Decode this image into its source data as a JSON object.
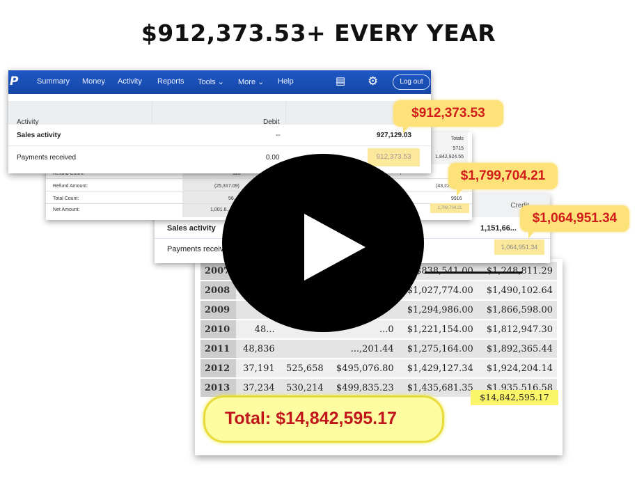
{
  "headline": "$912,373.53+ EVERY YEAR",
  "paypal": {
    "nav": [
      "Summary",
      "Money",
      "Activity",
      "Reports",
      "Tools ⌄",
      "More ⌄",
      "Help"
    ],
    "logout": "Log out",
    "icons": {
      "message": "▤",
      "settings": "⚙"
    },
    "columns": {
      "activity": "Activity",
      "debit": "Debit",
      "credit": "Credit"
    },
    "rows": [
      {
        "label": "Sales activity",
        "debit": "--",
        "credit": "927,129.03"
      },
      {
        "label": "Payments received",
        "debit": "0.00",
        "credit": "912,373.53"
      }
    ]
  },
  "panel2": {
    "totals_header": "Totals",
    "totals_values": [
      "9715",
      "1,842,924.55"
    ],
    "rows": [
      {
        "label": "Refund Count:",
        "v1": "120",
        "v2": "7"
      },
      {
        "label": "Refund Amount:",
        "v1": "(25,317.09)",
        "v2": "(43,22..."
      },
      {
        "label": "Total Count:",
        "v1": "56...",
        "v2": "9916"
      },
      {
        "label": "Net Amount:",
        "v1": "1,001.6...",
        "v2": "1,799,704.21"
      }
    ]
  },
  "panel3": {
    "credit_header": "Credit",
    "sales_label": "Sales activity",
    "sales_value": "1,151,66...",
    "payments_label": "Payments receive...",
    "payments_value": "1,064,951.34"
  },
  "year_table": [
    {
      "year": "2007",
      "c1": "",
      "c2": "",
      "c3": "",
      "c4": "$838,541.00",
      "c5": "$1,248,811.29"
    },
    {
      "year": "2008",
      "c1": "",
      "c2": "",
      "c3": "",
      "c4": "$1,027,774.00",
      "c5": "$1,490,102.64"
    },
    {
      "year": "2009",
      "c1": "",
      "c2": "",
      "c3": "",
      "c4": "$1,294,986.00",
      "c5": "$1,866,598.00"
    },
    {
      "year": "2010",
      "c1": "48...",
      "c2": "",
      "c3": "...0",
      "c4": "$1,221,154.00",
      "c5": "$1,812,947.30"
    },
    {
      "year": "2011",
      "c1": "48,836",
      "c2": "",
      "c3": "...,201.44",
      "c4": "$1,275,164.00",
      "c5": "$1,892,365.44"
    },
    {
      "year": "2012",
      "c1": "37,191",
      "c2": "525,658",
      "c3": "$495,076.80",
      "c4": "$1,429,127.34",
      "c5": "$1,924,204.14"
    },
    {
      "year": "2013",
      "c1": "37,234",
      "c2": "530,214",
      "c3": "$499,835.23",
      "c4": "$1,435,681.35",
      "c5": "$1,935,516.58"
    }
  ],
  "grand_total_cell": "$14,842,595.17",
  "total_bubble": "Total: $14,842,595.17",
  "callouts": [
    "$912,373.53",
    "$1,799,704.21",
    "$1,064,951.34"
  ],
  "colors": {
    "paypal_nav": "#1f58c4",
    "callout_bg": "#fde27a",
    "callout_text": "#d21b1b",
    "total_text": "#c0151b"
  }
}
